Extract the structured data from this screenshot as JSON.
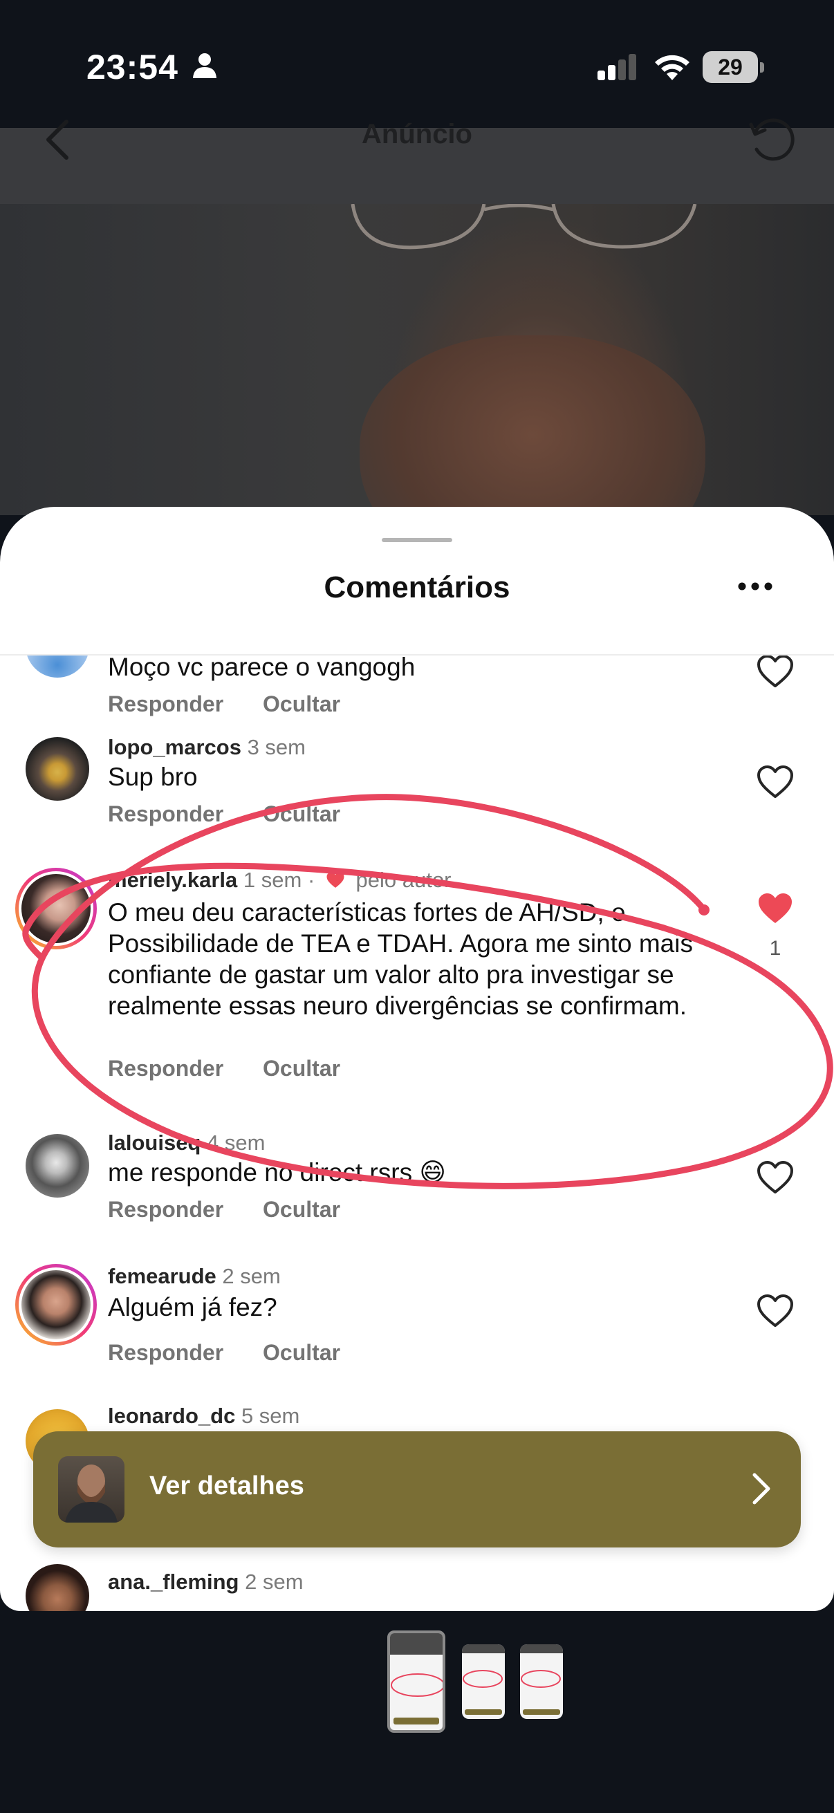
{
  "status_bar": {
    "time": "23:54",
    "battery": "29"
  },
  "ad": {
    "title": "Anúncio"
  },
  "sheet": {
    "title": "Comentários"
  },
  "actions": {
    "reply": "Responder",
    "hide": "Ocultar"
  },
  "comments": [
    {
      "username": "",
      "time": "",
      "text": "Moço vc parece o vangogh",
      "liked": false
    },
    {
      "username": "lopo_marcos",
      "time": "3 sem",
      "text": "Sup bro",
      "liked": false
    },
    {
      "username": "meriely.karla",
      "time": "1 sem",
      "author_like": "pelo autor",
      "text": "O meu deu características fortes de AH/SD, e Possibilidade de TEA e TDAH. Agora me sinto mais confiante de gastar um valor alto pra investigar se realmente essas neuro divergências se confirmam.",
      "liked": true,
      "like_count": "1"
    },
    {
      "username": "lalouiseq",
      "time": "4 sem",
      "text": "me responde no direct rsrs 😄",
      "liked": false
    },
    {
      "username": "femearude",
      "time": "2 sem",
      "text": "Alguém já fez?",
      "liked": false
    },
    {
      "username": "leonardo_dc",
      "time": "5 sem",
      "text": "",
      "liked": false
    },
    {
      "username": "ana._fleming",
      "time": "2 sem",
      "text": "",
      "liked": false
    }
  ],
  "details_banner": {
    "label": "Ver detalhes"
  },
  "colors": {
    "banner": "#7a6e35",
    "like_red": "#ed4956",
    "annotation_red": "#e8455e"
  }
}
